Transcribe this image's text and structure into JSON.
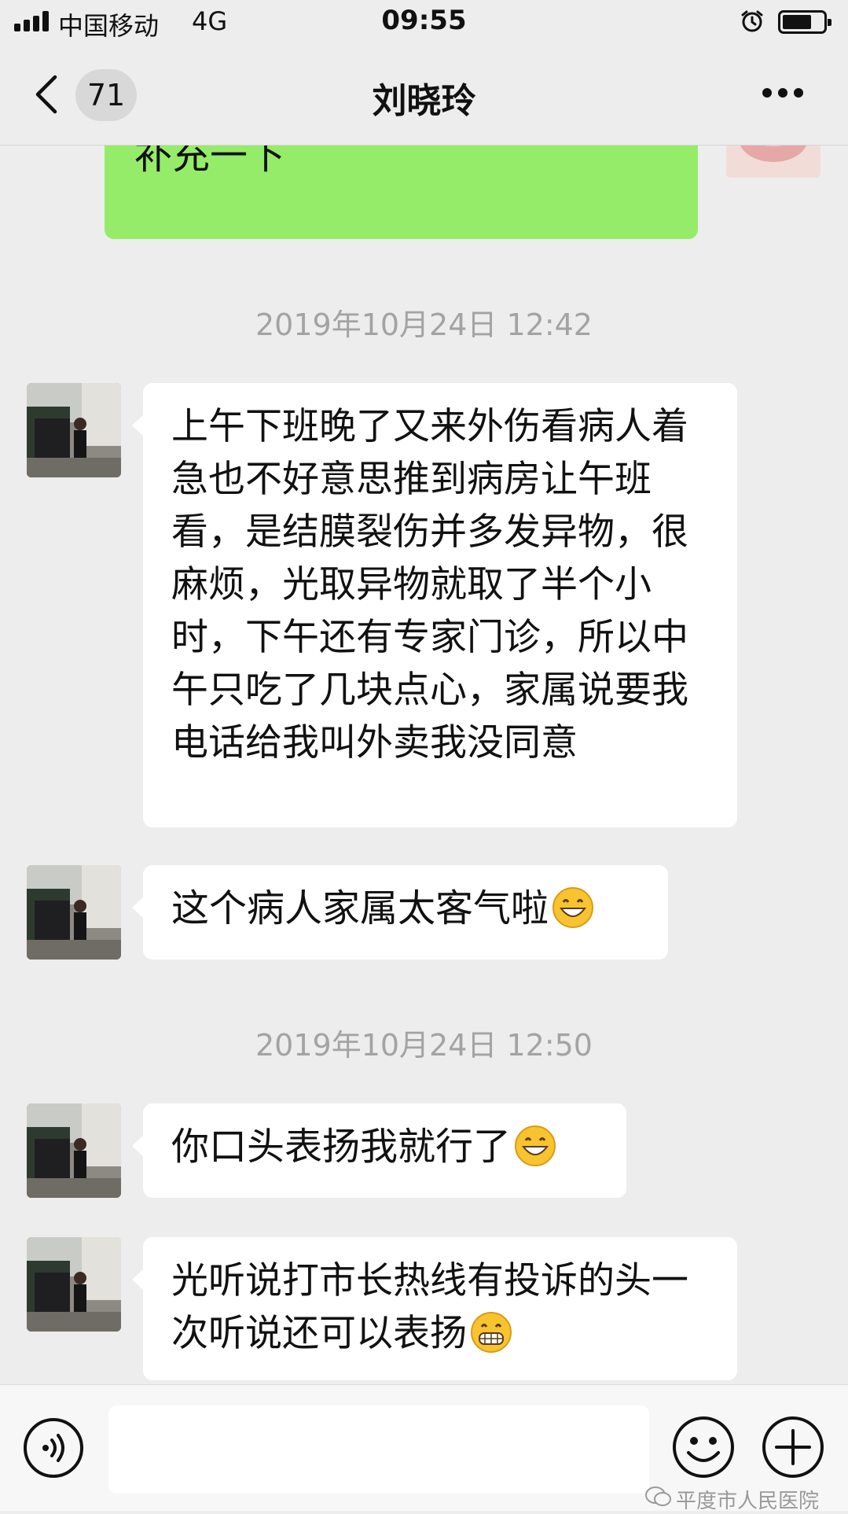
{
  "status_bar": {
    "carrier": "中国移动",
    "network": "4G",
    "time": "09:55"
  },
  "nav": {
    "unread_count": "71",
    "contact_name": "刘晓玲"
  },
  "messages": [
    {
      "type": "outgoing",
      "text": "你有时间的话把大体经过再补充一下",
      "visible_text": "充一下"
    },
    {
      "type": "timestamp",
      "text": "2019年10月24日 12:42"
    },
    {
      "type": "incoming",
      "text": "上午下班晚了又来外伤看病人着急也不好意思推到病房让午班看，是结膜裂伤并多发异物，很麻烦，光取异物就取了半个小时，下午还有专家门诊，所以中午只吃了几块点心，家属说要我电话给我叫外卖我没同意"
    },
    {
      "type": "incoming",
      "text": "这个病人家属太客气啦",
      "emoji": "grinning-face-icon"
    },
    {
      "type": "timestamp",
      "text": "2019年10月24日 12:50"
    },
    {
      "type": "incoming",
      "text": "你口头表扬我就行了",
      "emoji": "grinning-face-icon"
    },
    {
      "type": "incoming",
      "text": "光听说打市长热线有投诉的头一次听说还可以表扬",
      "emoji": "grimacing-face-icon"
    }
  ],
  "input_bar": {
    "value": ""
  },
  "watermark": "平度市人民医院",
  "colors": {
    "background": "#ededed",
    "outgoing_bubble": "#95ec69",
    "incoming_bubble": "#ffffff",
    "timestamp_text": "#a3a3a3"
  }
}
